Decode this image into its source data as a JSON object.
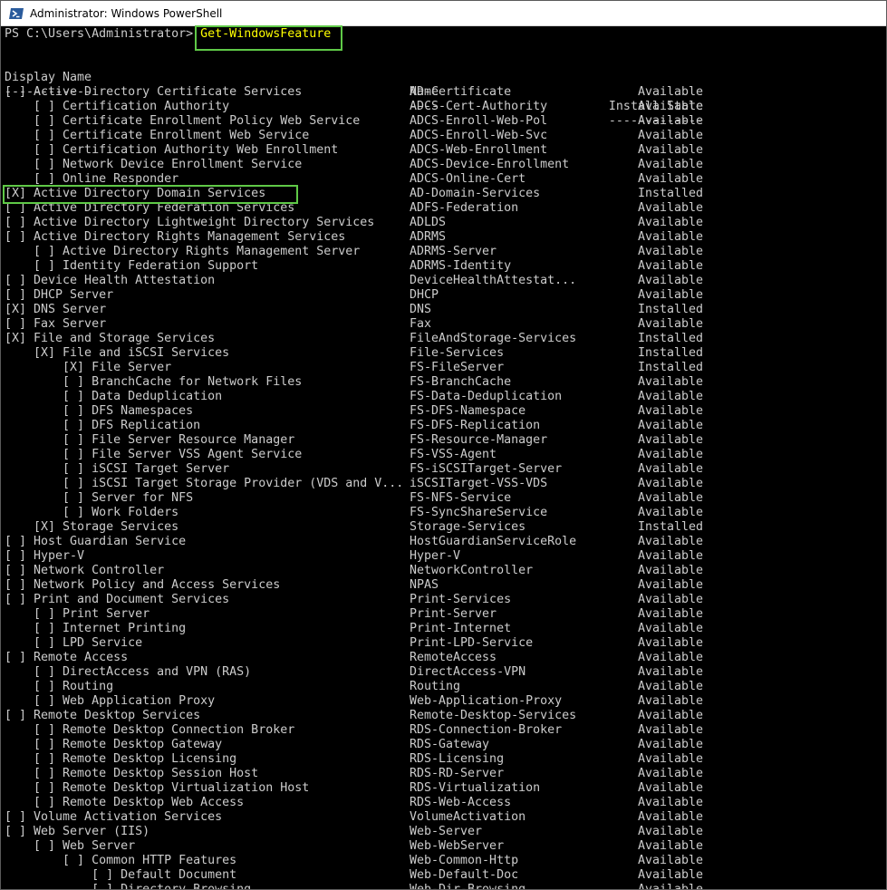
{
  "window": {
    "title": "Administrator: Windows PowerShell",
    "icon": "powershell-icon",
    "highlight_color": "#5fc947",
    "text_color": "#cccccc",
    "command_color": "#ffff00",
    "background": "#000000"
  },
  "prompt": {
    "path": "PS C:\\Users\\Administrator> ",
    "command": "Get-WindowsFeature"
  },
  "headers": {
    "display_name": "Display Name",
    "name": "Name",
    "install_state": "Install State",
    "display_name_rule": "------------",
    "name_rule": "----",
    "install_state_rule": "-------------"
  },
  "features": [
    {
      "display": "[ ] Active Directory Certificate Services",
      "name": "AD-Certificate",
      "state": "Available"
    },
    {
      "display": "    [ ] Certification Authority",
      "name": "ADCS-Cert-Authority",
      "state": "Available"
    },
    {
      "display": "    [ ] Certificate Enrollment Policy Web Service",
      "name": "ADCS-Enroll-Web-Pol",
      "state": "Available"
    },
    {
      "display": "    [ ] Certificate Enrollment Web Service",
      "name": "ADCS-Enroll-Web-Svc",
      "state": "Available"
    },
    {
      "display": "    [ ] Certification Authority Web Enrollment",
      "name": "ADCS-Web-Enrollment",
      "state": "Available"
    },
    {
      "display": "    [ ] Network Device Enrollment Service",
      "name": "ADCS-Device-Enrollment",
      "state": "Available"
    },
    {
      "display": "    [ ] Online Responder",
      "name": "ADCS-Online-Cert",
      "state": "Available"
    },
    {
      "display": "[X] Active Directory Domain Services",
      "name": "AD-Domain-Services",
      "state": "Installed"
    },
    {
      "display": "[ ] Active Directory Federation Services",
      "name": "ADFS-Federation",
      "state": "Available"
    },
    {
      "display": "[ ] Active Directory Lightweight Directory Services",
      "name": "ADLDS",
      "state": "Available"
    },
    {
      "display": "[ ] Active Directory Rights Management Services",
      "name": "ADRMS",
      "state": "Available"
    },
    {
      "display": "    [ ] Active Directory Rights Management Server",
      "name": "ADRMS-Server",
      "state": "Available"
    },
    {
      "display": "    [ ] Identity Federation Support",
      "name": "ADRMS-Identity",
      "state": "Available"
    },
    {
      "display": "[ ] Device Health Attestation",
      "name": "DeviceHealthAttestat...",
      "state": "Available"
    },
    {
      "display": "[ ] DHCP Server",
      "name": "DHCP",
      "state": "Available"
    },
    {
      "display": "[X] DNS Server",
      "name": "DNS",
      "state": "Installed"
    },
    {
      "display": "[ ] Fax Server",
      "name": "Fax",
      "state": "Available"
    },
    {
      "display": "[X] File and Storage Services",
      "name": "FileAndStorage-Services",
      "state": "Installed"
    },
    {
      "display": "    [X] File and iSCSI Services",
      "name": "File-Services",
      "state": "Installed"
    },
    {
      "display": "        [X] File Server",
      "name": "FS-FileServer",
      "state": "Installed"
    },
    {
      "display": "        [ ] BranchCache for Network Files",
      "name": "FS-BranchCache",
      "state": "Available"
    },
    {
      "display": "        [ ] Data Deduplication",
      "name": "FS-Data-Deduplication",
      "state": "Available"
    },
    {
      "display": "        [ ] DFS Namespaces",
      "name": "FS-DFS-Namespace",
      "state": "Available"
    },
    {
      "display": "        [ ] DFS Replication",
      "name": "FS-DFS-Replication",
      "state": "Available"
    },
    {
      "display": "        [ ] File Server Resource Manager",
      "name": "FS-Resource-Manager",
      "state": "Available"
    },
    {
      "display": "        [ ] File Server VSS Agent Service",
      "name": "FS-VSS-Agent",
      "state": "Available"
    },
    {
      "display": "        [ ] iSCSI Target Server",
      "name": "FS-iSCSITarget-Server",
      "state": "Available"
    },
    {
      "display": "        [ ] iSCSI Target Storage Provider (VDS and V...",
      "name": "iSCSITarget-VSS-VDS",
      "state": "Available"
    },
    {
      "display": "        [ ] Server for NFS",
      "name": "FS-NFS-Service",
      "state": "Available"
    },
    {
      "display": "        [ ] Work Folders",
      "name": "FS-SyncShareService",
      "state": "Available"
    },
    {
      "display": "    [X] Storage Services",
      "name": "Storage-Services",
      "state": "Installed"
    },
    {
      "display": "[ ] Host Guardian Service",
      "name": "HostGuardianServiceRole",
      "state": "Available"
    },
    {
      "display": "[ ] Hyper-V",
      "name": "Hyper-V",
      "state": "Available"
    },
    {
      "display": "[ ] Network Controller",
      "name": "NetworkController",
      "state": "Available"
    },
    {
      "display": "[ ] Network Policy and Access Services",
      "name": "NPAS",
      "state": "Available"
    },
    {
      "display": "[ ] Print and Document Services",
      "name": "Print-Services",
      "state": "Available"
    },
    {
      "display": "    [ ] Print Server",
      "name": "Print-Server",
      "state": "Available"
    },
    {
      "display": "    [ ] Internet Printing",
      "name": "Print-Internet",
      "state": "Available"
    },
    {
      "display": "    [ ] LPD Service",
      "name": "Print-LPD-Service",
      "state": "Available"
    },
    {
      "display": "[ ] Remote Access",
      "name": "RemoteAccess",
      "state": "Available"
    },
    {
      "display": "    [ ] DirectAccess and VPN (RAS)",
      "name": "DirectAccess-VPN",
      "state": "Available"
    },
    {
      "display": "    [ ] Routing",
      "name": "Routing",
      "state": "Available"
    },
    {
      "display": "    [ ] Web Application Proxy",
      "name": "Web-Application-Proxy",
      "state": "Available"
    },
    {
      "display": "[ ] Remote Desktop Services",
      "name": "Remote-Desktop-Services",
      "state": "Available"
    },
    {
      "display": "    [ ] Remote Desktop Connection Broker",
      "name": "RDS-Connection-Broker",
      "state": "Available"
    },
    {
      "display": "    [ ] Remote Desktop Gateway",
      "name": "RDS-Gateway",
      "state": "Available"
    },
    {
      "display": "    [ ] Remote Desktop Licensing",
      "name": "RDS-Licensing",
      "state": "Available"
    },
    {
      "display": "    [ ] Remote Desktop Session Host",
      "name": "RDS-RD-Server",
      "state": "Available"
    },
    {
      "display": "    [ ] Remote Desktop Virtualization Host",
      "name": "RDS-Virtualization",
      "state": "Available"
    },
    {
      "display": "    [ ] Remote Desktop Web Access",
      "name": "RDS-Web-Access",
      "state": "Available"
    },
    {
      "display": "[ ] Volume Activation Services",
      "name": "VolumeActivation",
      "state": "Available"
    },
    {
      "display": "[ ] Web Server (IIS)",
      "name": "Web-Server",
      "state": "Available"
    },
    {
      "display": "    [ ] Web Server",
      "name": "Web-WebServer",
      "state": "Available"
    },
    {
      "display": "        [ ] Common HTTP Features",
      "name": "Web-Common-Http",
      "state": "Available"
    },
    {
      "display": "            [ ] Default Document",
      "name": "Web-Default-Doc",
      "state": "Available"
    },
    {
      "display": "            [ ] Directory Browsing",
      "name": "Web-Dir-Browsing",
      "state": "Available"
    }
  ]
}
